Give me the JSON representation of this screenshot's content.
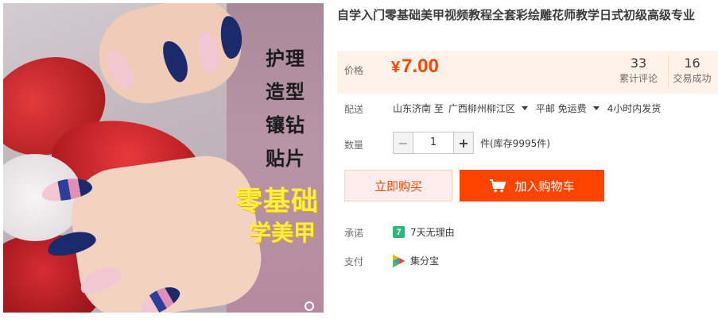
{
  "product": {
    "title": "自学入门零基础美甲视频教程全套彩绘雕花师教学日式初级高级专业",
    "image": {
      "side_texts": [
        "护理",
        "造型",
        "镶钻",
        "贴片"
      ],
      "headline": "零基础",
      "subline": "学美甲"
    }
  },
  "price": {
    "label": "价格",
    "currency": "¥",
    "value": "7.00",
    "reviews_count": "33",
    "reviews_label": "累计评论",
    "sales_count": "16",
    "sales_label": "交易成功"
  },
  "shipping": {
    "label": "配送",
    "from": "山东济南 至",
    "to": "广西柳州柳江区",
    "method": "平邮 免运费",
    "dispatch": "4小时内发货"
  },
  "quantity": {
    "label": "数量",
    "minus": "−",
    "value": "1",
    "plus": "+",
    "unit_stock": "件(库存9995件)"
  },
  "actions": {
    "buy_now": "立即购买",
    "add_to_cart": "加入购物车"
  },
  "service": {
    "promise_label": "承诺",
    "promise_icon": "7",
    "promise_text": "7天无理由",
    "payment_label": "支付",
    "payment_text": "集分宝"
  },
  "colors": {
    "accent": "#ff4400",
    "price_bg": "#fff2e8",
    "promise_green": "#33b37e"
  }
}
